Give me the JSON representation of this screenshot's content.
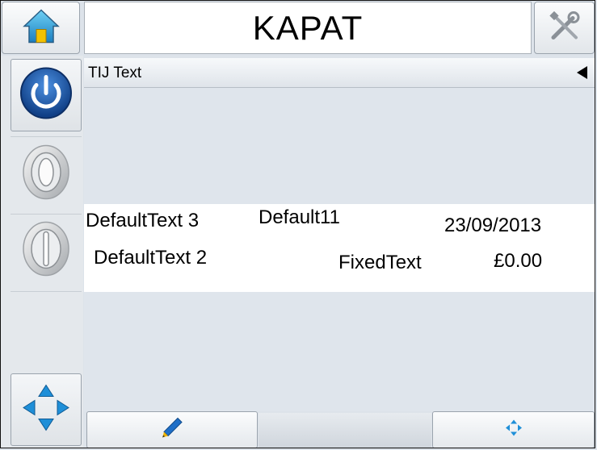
{
  "header": {
    "title": "KAPAT",
    "home_icon": "home-icon",
    "tools_icon": "tools-icon"
  },
  "side": {
    "power_icon": "power-icon",
    "start_icon": "start-icon",
    "stop_icon": "stop-icon",
    "nav_icon": "navigate-arrows-icon"
  },
  "message": {
    "name": "TIJ Text",
    "fields": [
      {
        "text": "DefaultText 3"
      },
      {
        "text": "Default11"
      },
      {
        "text": "23/09/2013"
      },
      {
        "text": "DefaultText 2"
      },
      {
        "text": "FixedText"
      },
      {
        "text": "£0.00"
      }
    ]
  },
  "bottom": {
    "edit_icon": "pencil-icon",
    "move_icon": "move-icon"
  },
  "colors": {
    "accent_blue": "#1f5fb0",
    "panel": "#dfe5ec",
    "print_area": "#ffffff"
  }
}
